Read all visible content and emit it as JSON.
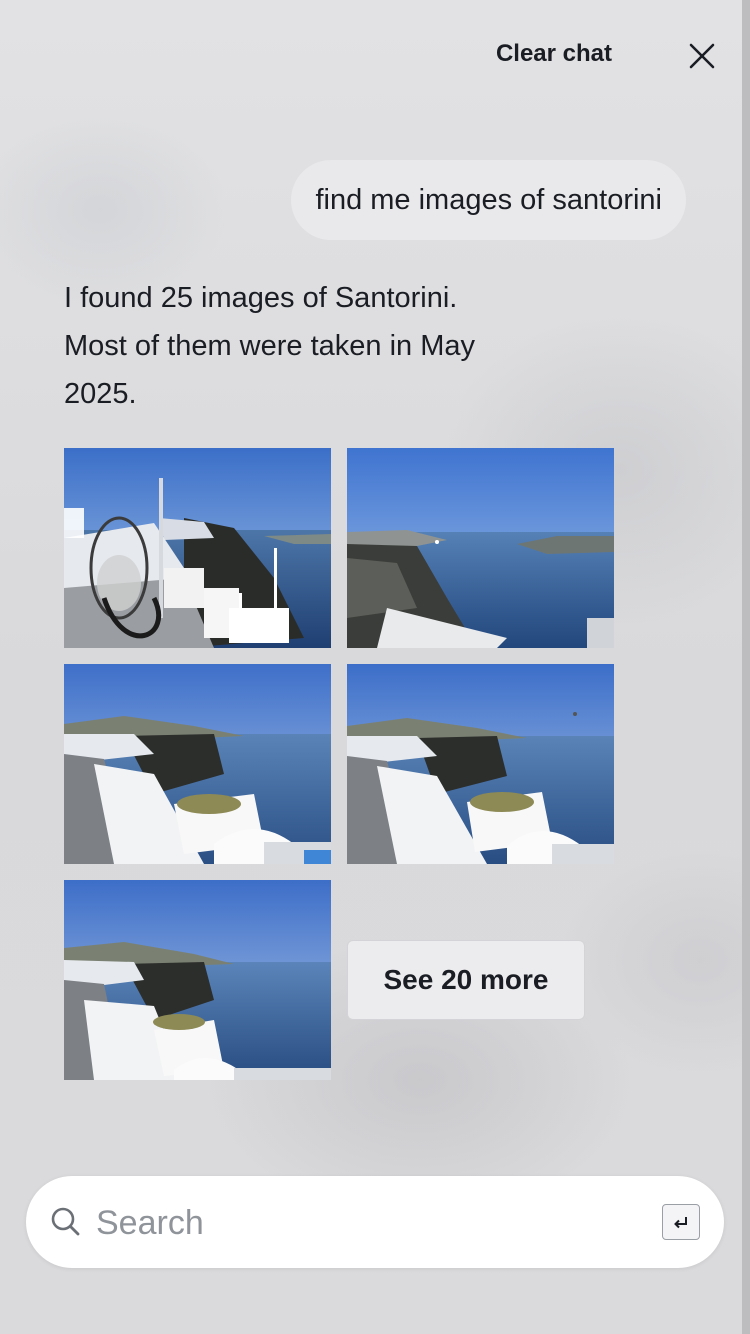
{
  "header": {
    "clear_chat_label": "Clear chat",
    "close_icon": "close-icon"
  },
  "conversation": {
    "user_message": "find me images of santorini",
    "assistant_message_lines": [
      "I found 25 images of Santorini.",
      "Most of them were taken in May",
      "2025."
    ]
  },
  "results": {
    "photos": [
      {
        "scene": "terrace-with-hanging-chair-and-caldera-view"
      },
      {
        "scene": "cliff-and-sea-panorama"
      },
      {
        "scene": "white-buildings-stairs-and-caldera"
      },
      {
        "scene": "white-buildings-stairs-and-caldera"
      },
      {
        "scene": "white-buildings-and-caldera"
      }
    ],
    "see_more_label": "See 20 more"
  },
  "search": {
    "placeholder": "Search",
    "value": "",
    "search_icon": "search-icon",
    "enter_icon": "enter-key-icon"
  },
  "colors": {
    "text": "#1a1d23",
    "bubble": "#e9e9eb",
    "placeholder": "#8f939a"
  }
}
